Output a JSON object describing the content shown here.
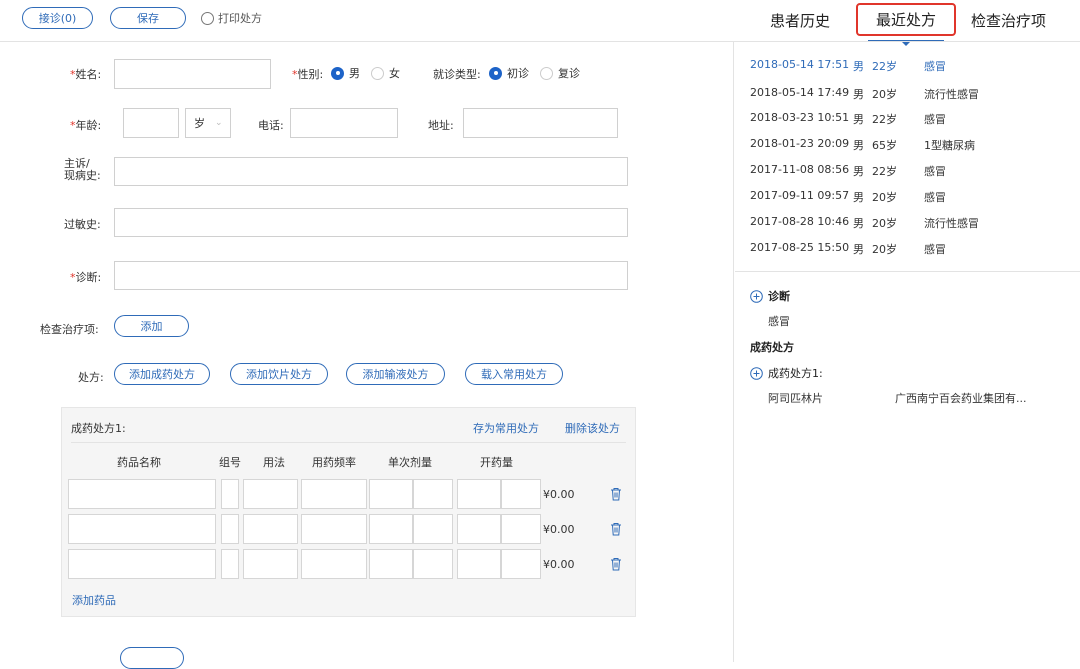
{
  "toolbar": {
    "reception_label": "接诊(0)",
    "save_label": "保存",
    "print_label": "打印处方"
  },
  "tabs": [
    {
      "label": "患者历史"
    },
    {
      "label": "最近处方",
      "active": true
    },
    {
      "label": "检查治疗项"
    }
  ],
  "form": {
    "name_label": "姓名:",
    "gender_label": "性别:",
    "gender_options": [
      "男",
      "女"
    ],
    "gender_selected": "男",
    "visit_type_label": "就诊类型:",
    "visit_type_options": [
      "初诊",
      "复诊"
    ],
    "visit_type_selected": "初诊",
    "age_label": "年龄:",
    "age_unit": "岁",
    "phone_label": "电话:",
    "address_label": "地址:",
    "complaint_label_1": "主诉/",
    "complaint_label_2": "现病史:",
    "allergy_label": "过敏史:",
    "diagnosis_label": "诊断:",
    "exam_label": "检查治疗项:",
    "exam_add_label": "添加",
    "rx_label": "处方:",
    "rx_buttons": [
      "添加成药处方",
      "添加饮片处方",
      "添加输液处方",
      "载入常用处方"
    ]
  },
  "prescription": {
    "title": "成药处方1:",
    "save_common": "存为常用处方",
    "delete": "删除该处方",
    "columns": [
      "药品名称",
      "组号",
      "用法",
      "用药频率",
      "单次剂量",
      "开药量"
    ],
    "rows": [
      {
        "price": "¥0.00"
      },
      {
        "price": "¥0.00"
      },
      {
        "price": "¥0.00"
      }
    ],
    "add_drug": "添加药品"
  },
  "history": [
    {
      "datetime": "2018-05-14 17:51",
      "gender": "男",
      "age": "22岁",
      "diagnosis": "感冒",
      "highlight": true
    },
    {
      "datetime": "2018-05-14 17:49",
      "gender": "男",
      "age": "20岁",
      "diagnosis": "流行性感冒"
    },
    {
      "datetime": "2018-03-23 10:51",
      "gender": "男",
      "age": "22岁",
      "diagnosis": "感冒"
    },
    {
      "datetime": "2018-01-23 20:09",
      "gender": "男",
      "age": "65岁",
      "diagnosis": "1型糖尿病"
    },
    {
      "datetime": "2017-11-08 08:56",
      "gender": "男",
      "age": "22岁",
      "diagnosis": "感冒"
    },
    {
      "datetime": "2017-09-11 09:57",
      "gender": "男",
      "age": "20岁",
      "diagnosis": "感冒"
    },
    {
      "datetime": "2017-08-28 10:46",
      "gender": "男",
      "age": "20岁",
      "diagnosis": "流行性感冒"
    },
    {
      "datetime": "2017-08-25 15:50",
      "gender": "男",
      "age": "20岁",
      "diagnosis": "感冒"
    }
  ],
  "detail": {
    "diagnosis_title": "诊断",
    "diagnosis_value": "感冒",
    "section_title": "成药处方",
    "rx_title": "成药处方1:",
    "drug_name": "阿司匹林片",
    "drug_maker": "广西南宁百会药业集团有..."
  },
  "colors": {
    "accent": "#2f6bb8",
    "active_tab_border": "#e0352b",
    "required": "#e0352b"
  }
}
